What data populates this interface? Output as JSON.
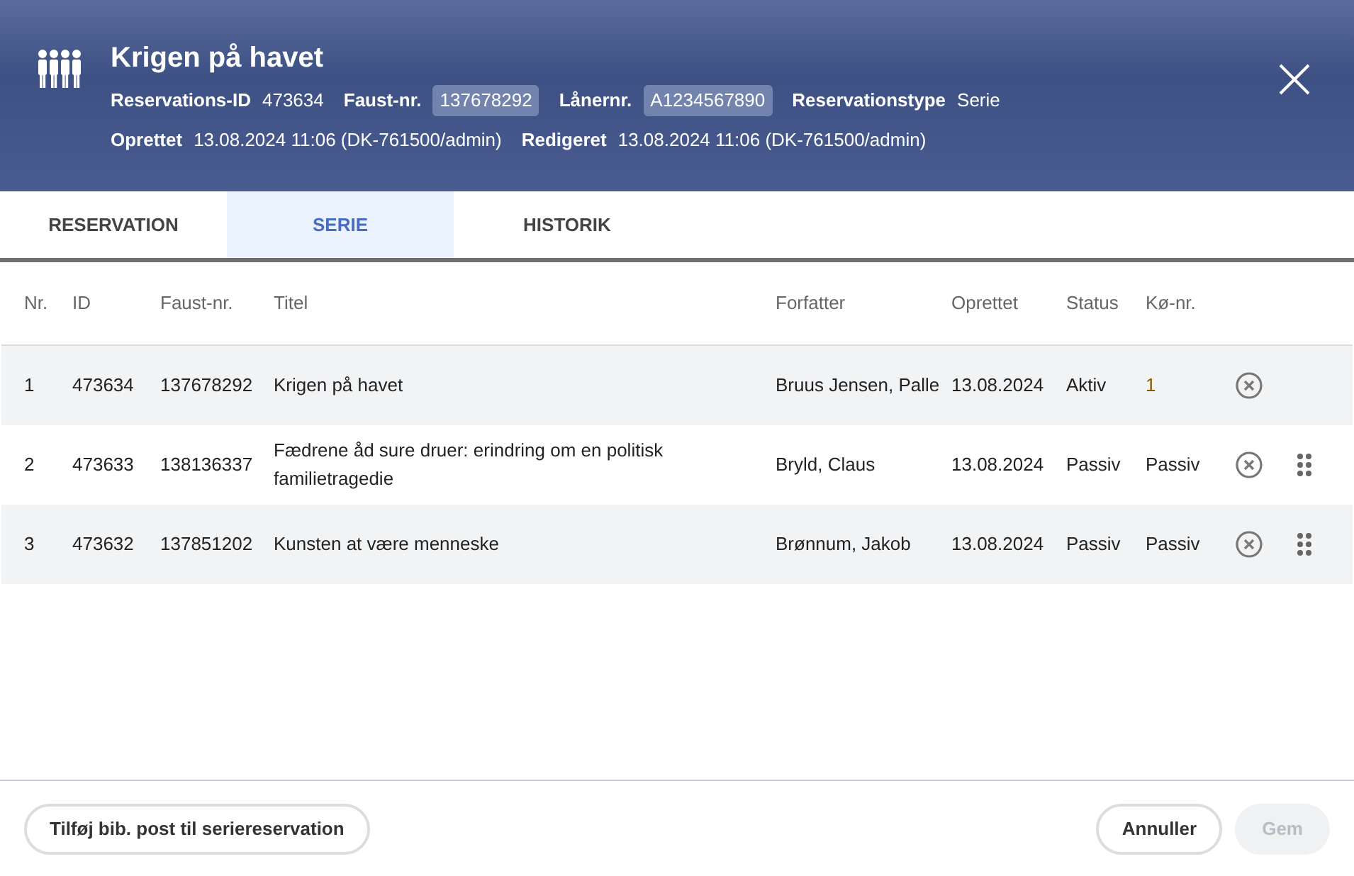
{
  "header": {
    "title": "Krigen på havet",
    "meta_rows": [
      [
        {
          "label": "Reservations-ID",
          "value": "473634",
          "highlighted": false
        },
        {
          "label": "Faust-nr.",
          "value": "137678292",
          "highlighted": true
        },
        {
          "label": "Lånernr.",
          "value": "A1234567890",
          "highlighted": true
        },
        {
          "label": "Reservationstype",
          "value": "Serie",
          "highlighted": false
        }
      ],
      [
        {
          "label": "Oprettet",
          "value": "13.08.2024 11:06 (DK-761500/admin)",
          "highlighted": false
        },
        {
          "label": "Redigeret",
          "value": "13.08.2024 11:06 (DK-761500/admin)",
          "highlighted": false
        }
      ]
    ]
  },
  "tabs": [
    {
      "label": "RESERVATION",
      "selected": false
    },
    {
      "label": "SERIE",
      "selected": true
    },
    {
      "label": "HISTORIK",
      "selected": false
    }
  ],
  "table": {
    "columns": [
      "Nr.",
      "ID",
      "Faust-nr.",
      "Titel",
      "Forfatter",
      "Oprettet",
      "Status",
      "Kø-nr."
    ],
    "rows": [
      {
        "cells": [
          "1",
          "473634",
          "137678292",
          "Krigen på havet",
          "Bruus Jensen, Palle",
          "13.08.2024",
          "Aktiv",
          "1"
        ],
        "draggable": false
      },
      {
        "cells": [
          "2",
          "473633",
          "138136337",
          "Fædrene åd sure druer: erindring om en politisk familietragedie",
          "Bryld, Claus",
          "13.08.2024",
          "Passiv",
          "Passiv"
        ],
        "draggable": true
      },
      {
        "cells": [
          "3",
          "473632",
          "137851202",
          "Kunsten at være menneske",
          "Brønnum, Jakob",
          "13.08.2024",
          "Passiv",
          "Passiv"
        ],
        "draggable": true
      }
    ]
  },
  "footer": {
    "add_button": "Tilføj bib. post til seriereservation",
    "cancel_button": "Annuller",
    "save_button": {
      "label": "Gem",
      "disabled": true
    }
  }
}
